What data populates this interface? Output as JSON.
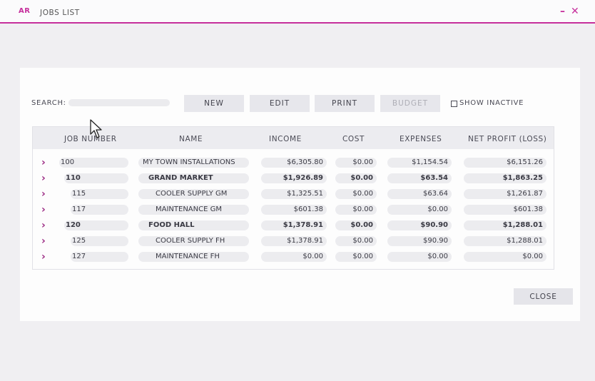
{
  "window": {
    "logo": "AR",
    "title": "JOBS LIST",
    "minimize": "–",
    "close": "✕"
  },
  "toolbar": {
    "search_label": "SEARCH:",
    "search_value": "",
    "new_label": "NEW",
    "edit_label": "EDIT",
    "print_label": "PRINT",
    "budget_label": "BUDGET",
    "show_inactive_label": "SHOW INACTIVE",
    "show_inactive_checked": false
  },
  "table": {
    "columns": [
      "JOB NUMBER",
      "NAME",
      "INCOME",
      "COST",
      "EXPENSES",
      "NET PROFIT (LOSS)"
    ],
    "rows": [
      {
        "job": "100",
        "name": "MY TOWN INSTALLATIONS",
        "income": "$6,305.80",
        "cost": "$0.00",
        "expenses": "$1,154.54",
        "net": "$6,151.26",
        "bold": false,
        "level": 0
      },
      {
        "job": "110",
        "name": "GRAND MARKET",
        "income": "$1,926.89",
        "cost": "$0.00",
        "expenses": "$63.54",
        "net": "$1,863.25",
        "bold": true,
        "level": 1
      },
      {
        "job": "115",
        "name": "COOLER SUPPLY GM",
        "income": "$1,325.51",
        "cost": "$0.00",
        "expenses": "$63.64",
        "net": "$1,261.87",
        "bold": false,
        "level": 2
      },
      {
        "job": "117",
        "name": "MAINTENANCE GM",
        "income": "$601.38",
        "cost": "$0.00",
        "expenses": "$0.00",
        "net": "$601.38",
        "bold": false,
        "level": 2
      },
      {
        "job": "120",
        "name": "FOOD HALL",
        "income": "$1,378.91",
        "cost": "$0.00",
        "expenses": "$90.90",
        "net": "$1,288.01",
        "bold": true,
        "level": 1
      },
      {
        "job": "125",
        "name": "COOLER SUPPLY FH",
        "income": "$1,378.91",
        "cost": "$0.00",
        "expenses": "$90.90",
        "net": "$1,288.01",
        "bold": false,
        "level": 2
      },
      {
        "job": "127",
        "name": "MAINTENANCE FH",
        "income": "$0.00",
        "cost": "$0.00",
        "expenses": "$0.00",
        "net": "$0.00",
        "bold": false,
        "level": 2
      }
    ]
  },
  "footer": {
    "close_label": "CLOSE"
  },
  "colors": {
    "accent": "#c62f9c",
    "chevron": "#9b2a83",
    "button_bg": "#e7e7ec"
  },
  "icons": {
    "row_expand": "chevron-right-icon",
    "pointer": "mouse-cursor-icon"
  }
}
